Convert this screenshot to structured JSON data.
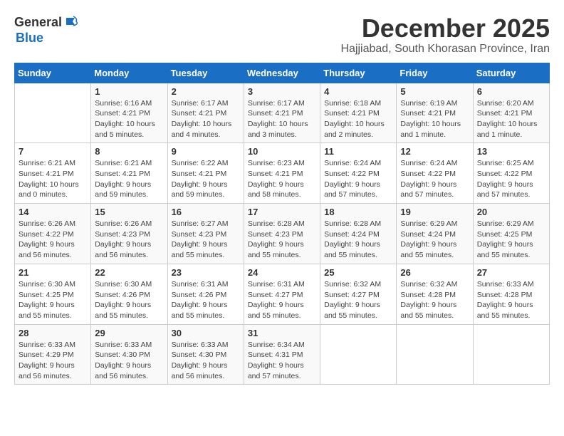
{
  "logo": {
    "general": "General",
    "blue": "Blue"
  },
  "title": {
    "month": "December 2025",
    "location": "Hajjiabad, South Khorasan Province, Iran"
  },
  "days_header": [
    "Sunday",
    "Monday",
    "Tuesday",
    "Wednesday",
    "Thursday",
    "Friday",
    "Saturday"
  ],
  "weeks": [
    [
      {
        "day": "",
        "sunrise": "",
        "sunset": "",
        "daylight": ""
      },
      {
        "day": "1",
        "sunrise": "Sunrise: 6:16 AM",
        "sunset": "Sunset: 4:21 PM",
        "daylight": "Daylight: 10 hours and 5 minutes."
      },
      {
        "day": "2",
        "sunrise": "Sunrise: 6:17 AM",
        "sunset": "Sunset: 4:21 PM",
        "daylight": "Daylight: 10 hours and 4 minutes."
      },
      {
        "day": "3",
        "sunrise": "Sunrise: 6:17 AM",
        "sunset": "Sunset: 4:21 PM",
        "daylight": "Daylight: 10 hours and 3 minutes."
      },
      {
        "day": "4",
        "sunrise": "Sunrise: 6:18 AM",
        "sunset": "Sunset: 4:21 PM",
        "daylight": "Daylight: 10 hours and 2 minutes."
      },
      {
        "day": "5",
        "sunrise": "Sunrise: 6:19 AM",
        "sunset": "Sunset: 4:21 PM",
        "daylight": "Daylight: 10 hours and 1 minute."
      },
      {
        "day": "6",
        "sunrise": "Sunrise: 6:20 AM",
        "sunset": "Sunset: 4:21 PM",
        "daylight": "Daylight: 10 hours and 1 minute."
      }
    ],
    [
      {
        "day": "7",
        "sunrise": "Sunrise: 6:21 AM",
        "sunset": "Sunset: 4:21 PM",
        "daylight": "Daylight: 10 hours and 0 minutes."
      },
      {
        "day": "8",
        "sunrise": "Sunrise: 6:21 AM",
        "sunset": "Sunset: 4:21 PM",
        "daylight": "Daylight: 9 hours and 59 minutes."
      },
      {
        "day": "9",
        "sunrise": "Sunrise: 6:22 AM",
        "sunset": "Sunset: 4:21 PM",
        "daylight": "Daylight: 9 hours and 59 minutes."
      },
      {
        "day": "10",
        "sunrise": "Sunrise: 6:23 AM",
        "sunset": "Sunset: 4:21 PM",
        "daylight": "Daylight: 9 hours and 58 minutes."
      },
      {
        "day": "11",
        "sunrise": "Sunrise: 6:24 AM",
        "sunset": "Sunset: 4:22 PM",
        "daylight": "Daylight: 9 hours and 57 minutes."
      },
      {
        "day": "12",
        "sunrise": "Sunrise: 6:24 AM",
        "sunset": "Sunset: 4:22 PM",
        "daylight": "Daylight: 9 hours and 57 minutes."
      },
      {
        "day": "13",
        "sunrise": "Sunrise: 6:25 AM",
        "sunset": "Sunset: 4:22 PM",
        "daylight": "Daylight: 9 hours and 57 minutes."
      }
    ],
    [
      {
        "day": "14",
        "sunrise": "Sunrise: 6:26 AM",
        "sunset": "Sunset: 4:22 PM",
        "daylight": "Daylight: 9 hours and 56 minutes."
      },
      {
        "day": "15",
        "sunrise": "Sunrise: 6:26 AM",
        "sunset": "Sunset: 4:23 PM",
        "daylight": "Daylight: 9 hours and 56 minutes."
      },
      {
        "day": "16",
        "sunrise": "Sunrise: 6:27 AM",
        "sunset": "Sunset: 4:23 PM",
        "daylight": "Daylight: 9 hours and 55 minutes."
      },
      {
        "day": "17",
        "sunrise": "Sunrise: 6:28 AM",
        "sunset": "Sunset: 4:23 PM",
        "daylight": "Daylight: 9 hours and 55 minutes."
      },
      {
        "day": "18",
        "sunrise": "Sunrise: 6:28 AM",
        "sunset": "Sunset: 4:24 PM",
        "daylight": "Daylight: 9 hours and 55 minutes."
      },
      {
        "day": "19",
        "sunrise": "Sunrise: 6:29 AM",
        "sunset": "Sunset: 4:24 PM",
        "daylight": "Daylight: 9 hours and 55 minutes."
      },
      {
        "day": "20",
        "sunrise": "Sunrise: 6:29 AM",
        "sunset": "Sunset: 4:25 PM",
        "daylight": "Daylight: 9 hours and 55 minutes."
      }
    ],
    [
      {
        "day": "21",
        "sunrise": "Sunrise: 6:30 AM",
        "sunset": "Sunset: 4:25 PM",
        "daylight": "Daylight: 9 hours and 55 minutes."
      },
      {
        "day": "22",
        "sunrise": "Sunrise: 6:30 AM",
        "sunset": "Sunset: 4:26 PM",
        "daylight": "Daylight: 9 hours and 55 minutes."
      },
      {
        "day": "23",
        "sunrise": "Sunrise: 6:31 AM",
        "sunset": "Sunset: 4:26 PM",
        "daylight": "Daylight: 9 hours and 55 minutes."
      },
      {
        "day": "24",
        "sunrise": "Sunrise: 6:31 AM",
        "sunset": "Sunset: 4:27 PM",
        "daylight": "Daylight: 9 hours and 55 minutes."
      },
      {
        "day": "25",
        "sunrise": "Sunrise: 6:32 AM",
        "sunset": "Sunset: 4:27 PM",
        "daylight": "Daylight: 9 hours and 55 minutes."
      },
      {
        "day": "26",
        "sunrise": "Sunrise: 6:32 AM",
        "sunset": "Sunset: 4:28 PM",
        "daylight": "Daylight: 9 hours and 55 minutes."
      },
      {
        "day": "27",
        "sunrise": "Sunrise: 6:33 AM",
        "sunset": "Sunset: 4:28 PM",
        "daylight": "Daylight: 9 hours and 55 minutes."
      }
    ],
    [
      {
        "day": "28",
        "sunrise": "Sunrise: 6:33 AM",
        "sunset": "Sunset: 4:29 PM",
        "daylight": "Daylight: 9 hours and 56 minutes."
      },
      {
        "day": "29",
        "sunrise": "Sunrise: 6:33 AM",
        "sunset": "Sunset: 4:30 PM",
        "daylight": "Daylight: 9 hours and 56 minutes."
      },
      {
        "day": "30",
        "sunrise": "Sunrise: 6:33 AM",
        "sunset": "Sunset: 4:30 PM",
        "daylight": "Daylight: 9 hours and 56 minutes."
      },
      {
        "day": "31",
        "sunrise": "Sunrise: 6:34 AM",
        "sunset": "Sunset: 4:31 PM",
        "daylight": "Daylight: 9 hours and 57 minutes."
      },
      {
        "day": "",
        "sunrise": "",
        "sunset": "",
        "daylight": ""
      },
      {
        "day": "",
        "sunrise": "",
        "sunset": "",
        "daylight": ""
      },
      {
        "day": "",
        "sunrise": "",
        "sunset": "",
        "daylight": ""
      }
    ]
  ]
}
